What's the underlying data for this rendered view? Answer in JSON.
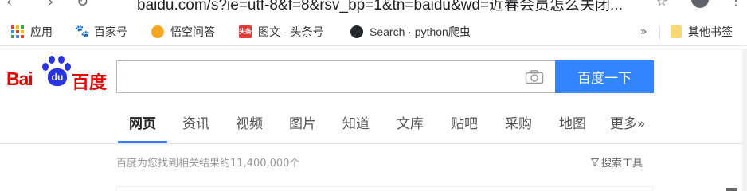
{
  "browser": {
    "url": "baidu.com/s?ie=utf-8&f=8&rsv_bp=1&tn=baidu&wd=近春会员怎么关闭..."
  },
  "bookmarks": [
    {
      "label": "应用",
      "icon": "apps-grid-icon"
    },
    {
      "label": "百家号",
      "icon": "baidu-paw-icon"
    },
    {
      "label": "悟空问答",
      "icon": "wukong-icon"
    },
    {
      "label": "图文 - 头条号",
      "icon": "toutiao-icon"
    },
    {
      "label": "Search · python爬虫",
      "icon": "github-icon"
    }
  ],
  "bookmarks_overflow": "»",
  "other_bookmarks": "其他书签",
  "logo": {
    "left": "Bai",
    "mid": "du",
    "right": "百度"
  },
  "search": {
    "value": "",
    "placeholder": "",
    "button": "百度一下"
  },
  "tabs": [
    "网页",
    "资讯",
    "视频",
    "图片",
    "知道",
    "文库",
    "贴吧",
    "采购",
    "地图",
    "更多»"
  ],
  "active_tab": "网页",
  "results": {
    "count_text": "百度为您找到相关结果约11,400,000个"
  },
  "tools": {
    "label": "搜索工具"
  },
  "colors": {
    "accent": "#3385ff",
    "brand_red": "#e10602",
    "brand_blue": "#2932e1"
  }
}
